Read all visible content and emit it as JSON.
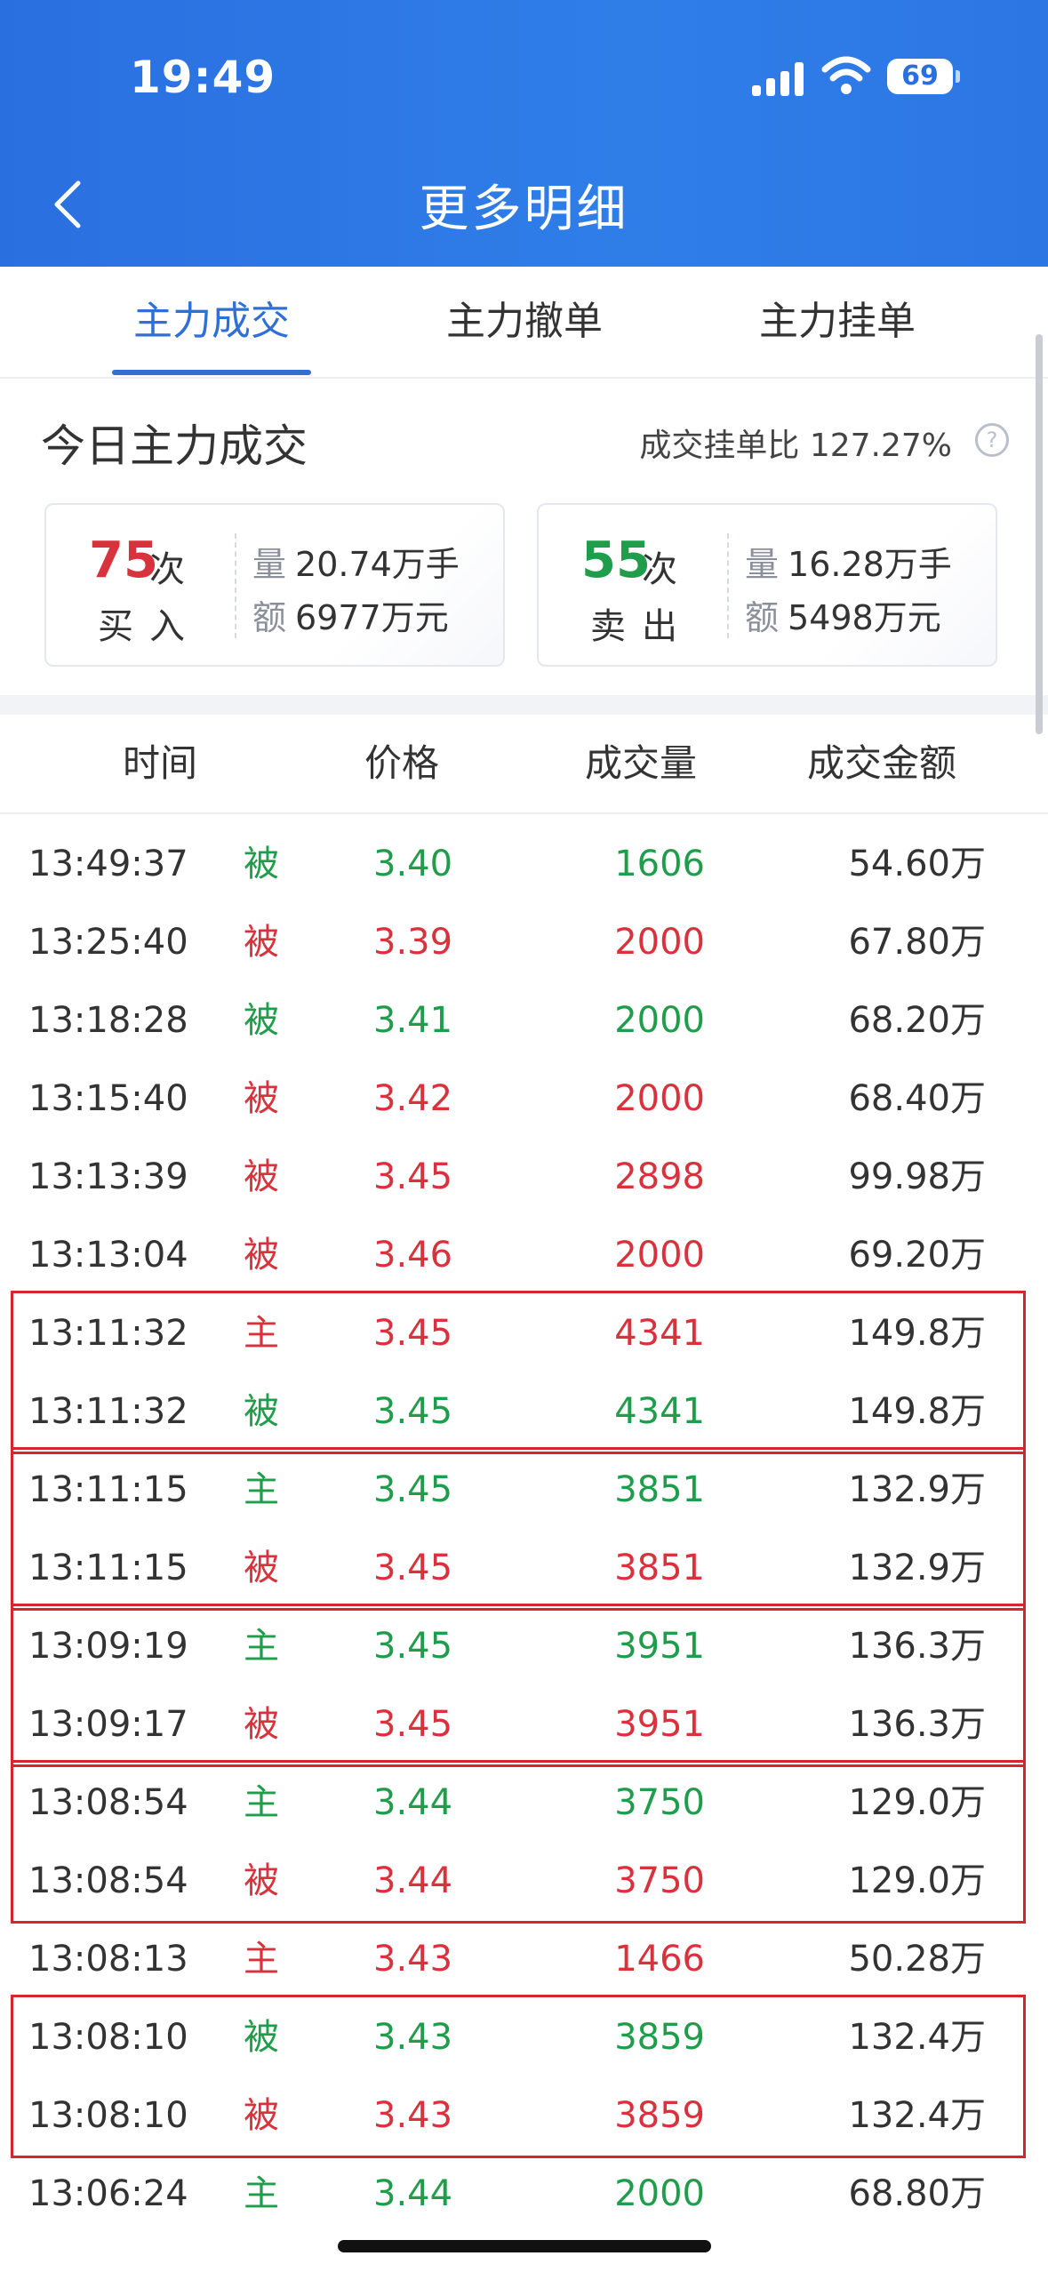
{
  "status": {
    "time": "19:49",
    "battery": "69"
  },
  "nav": {
    "title": "更多明细"
  },
  "tabs": [
    "主力成交",
    "主力撤单",
    "主力挂单"
  ],
  "summary": {
    "title": "今日主力成交",
    "ratio_label": "成交挂单比",
    "ratio_value": "127.27%",
    "buy": {
      "count": "75",
      "unit": "次",
      "label": "买入",
      "vol_key": "量",
      "vol": "20.74万手",
      "amt_key": "额",
      "amt": "6977万元"
    },
    "sell": {
      "count": "55",
      "unit": "次",
      "label": "卖出",
      "vol_key": "量",
      "vol": "16.28万手",
      "amt_key": "额",
      "amt": "5498万元"
    }
  },
  "columns": [
    "时间",
    "价格",
    "成交量",
    "成交金额"
  ],
  "rows": [
    {
      "time": "13:49:37",
      "type": "被",
      "price": "3.40",
      "vol": "1606",
      "amt": "54.60万",
      "color": "green"
    },
    {
      "time": "13:25:40",
      "type": "被",
      "price": "3.39",
      "vol": "2000",
      "amt": "67.80万",
      "color": "red"
    },
    {
      "time": "13:18:28",
      "type": "被",
      "price": "3.41",
      "vol": "2000",
      "amt": "68.20万",
      "color": "green"
    },
    {
      "time": "13:15:40",
      "type": "被",
      "price": "3.42",
      "vol": "2000",
      "amt": "68.40万",
      "color": "red"
    },
    {
      "time": "13:13:39",
      "type": "被",
      "price": "3.45",
      "vol": "2898",
      "amt": "99.98万",
      "color": "red"
    },
    {
      "time": "13:13:04",
      "type": "被",
      "price": "3.46",
      "vol": "2000",
      "amt": "69.20万",
      "color": "red"
    },
    {
      "time": "13:11:32",
      "type": "主",
      "price": "3.45",
      "vol": "4341",
      "amt": "149.8万",
      "color": "red"
    },
    {
      "time": "13:11:32",
      "type": "被",
      "price": "3.45",
      "vol": "4341",
      "amt": "149.8万",
      "color": "green"
    },
    {
      "time": "13:11:15",
      "type": "主",
      "price": "3.45",
      "vol": "3851",
      "amt": "132.9万",
      "color": "green"
    },
    {
      "time": "13:11:15",
      "type": "被",
      "price": "3.45",
      "vol": "3851",
      "amt": "132.9万",
      "color": "red"
    },
    {
      "time": "13:09:19",
      "type": "主",
      "price": "3.45",
      "vol": "3951",
      "amt": "136.3万",
      "color": "green"
    },
    {
      "time": "13:09:17",
      "type": "被",
      "price": "3.45",
      "vol": "3951",
      "amt": "136.3万",
      "color": "red"
    },
    {
      "time": "13:08:54",
      "type": "主",
      "price": "3.44",
      "vol": "3750",
      "amt": "129.0万",
      "color": "green"
    },
    {
      "time": "13:08:54",
      "type": "被",
      "price": "3.44",
      "vol": "3750",
      "amt": "129.0万",
      "color": "red"
    },
    {
      "time": "13:08:13",
      "type": "主",
      "price": "3.43",
      "vol": "1466",
      "amt": "50.28万",
      "color": "red"
    },
    {
      "time": "13:08:10",
      "type": "被",
      "price": "3.43",
      "vol": "3859",
      "amt": "132.4万",
      "color": "green"
    },
    {
      "time": "13:08:10",
      "type": "被",
      "price": "3.43",
      "vol": "3859",
      "amt": "132.4万",
      "color": "red"
    },
    {
      "time": "13:06:24",
      "type": "主",
      "price": "3.44",
      "vol": "2000",
      "amt": "68.80万",
      "color": "green"
    }
  ],
  "highlight_groups": [
    [
      6,
      7
    ],
    [
      8,
      9
    ],
    [
      10,
      11
    ],
    [
      12,
      13
    ],
    [
      15,
      16
    ]
  ],
  "colors": {
    "accent": "#2f6fd6",
    "up": "#d8323c",
    "down": "#1f9d4b",
    "highlight": "#d6252f"
  }
}
